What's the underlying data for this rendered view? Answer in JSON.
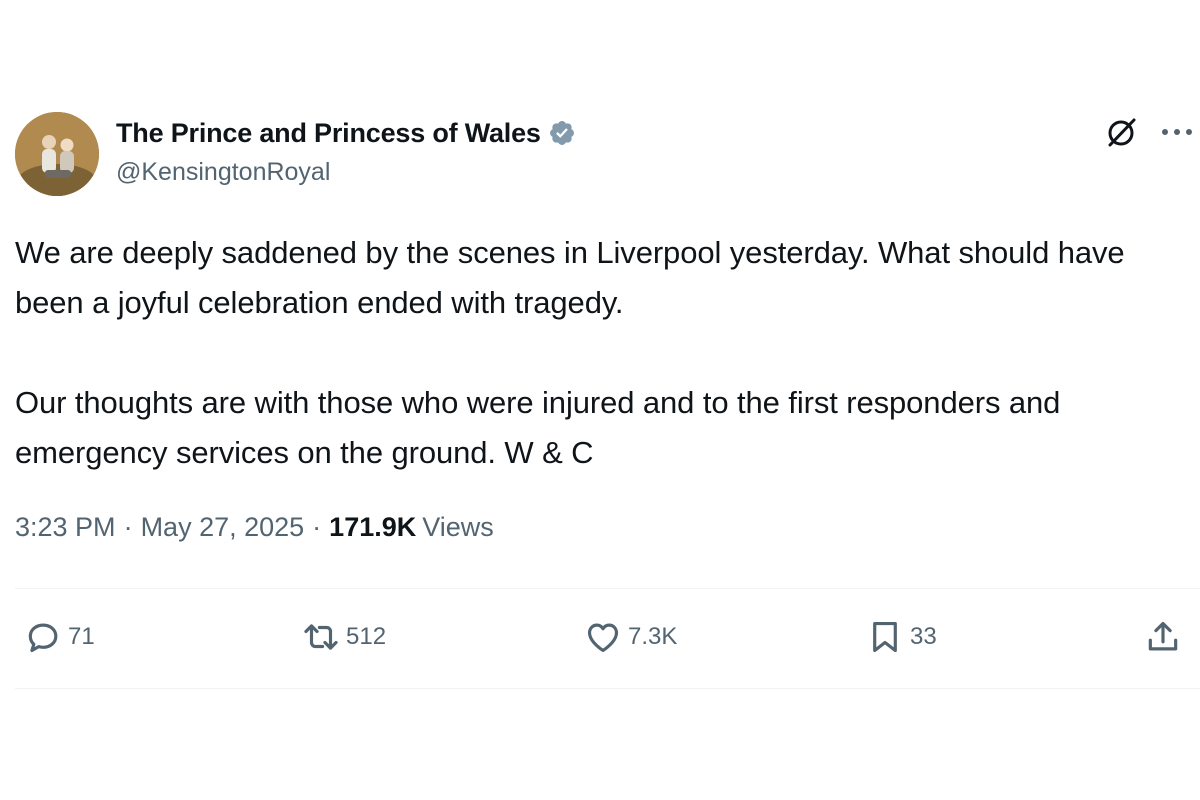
{
  "author": {
    "display_name": "The Prince and Princess of Wales",
    "handle": "@KensingtonRoyal",
    "verified": true,
    "verified_color": "#829aab"
  },
  "tweet": {
    "text": "We are deeply saddened by the scenes in Liverpool yesterday. What should have been a joyful celebration ended with tragedy.\n\nOur thoughts are with those who were injured and to the first responders and emergency services on the ground. W & C",
    "time": "3:23 PM",
    "date": "May 27, 2025",
    "separator": "·",
    "views_count": "171.9K",
    "views_label": "Views"
  },
  "actions": {
    "replies": "71",
    "reposts": "512",
    "likes": "7.3K",
    "bookmarks": "33"
  },
  "icons": {
    "header_grok": "grok-icon",
    "header_more": "more-icon",
    "reply": "reply-icon",
    "repost": "repost-icon",
    "like": "heart-icon",
    "bookmark": "bookmark-icon",
    "share": "share-icon"
  },
  "colors": {
    "text_primary": "#0f1419",
    "text_secondary": "#536471",
    "divider": "#eff3f4"
  }
}
